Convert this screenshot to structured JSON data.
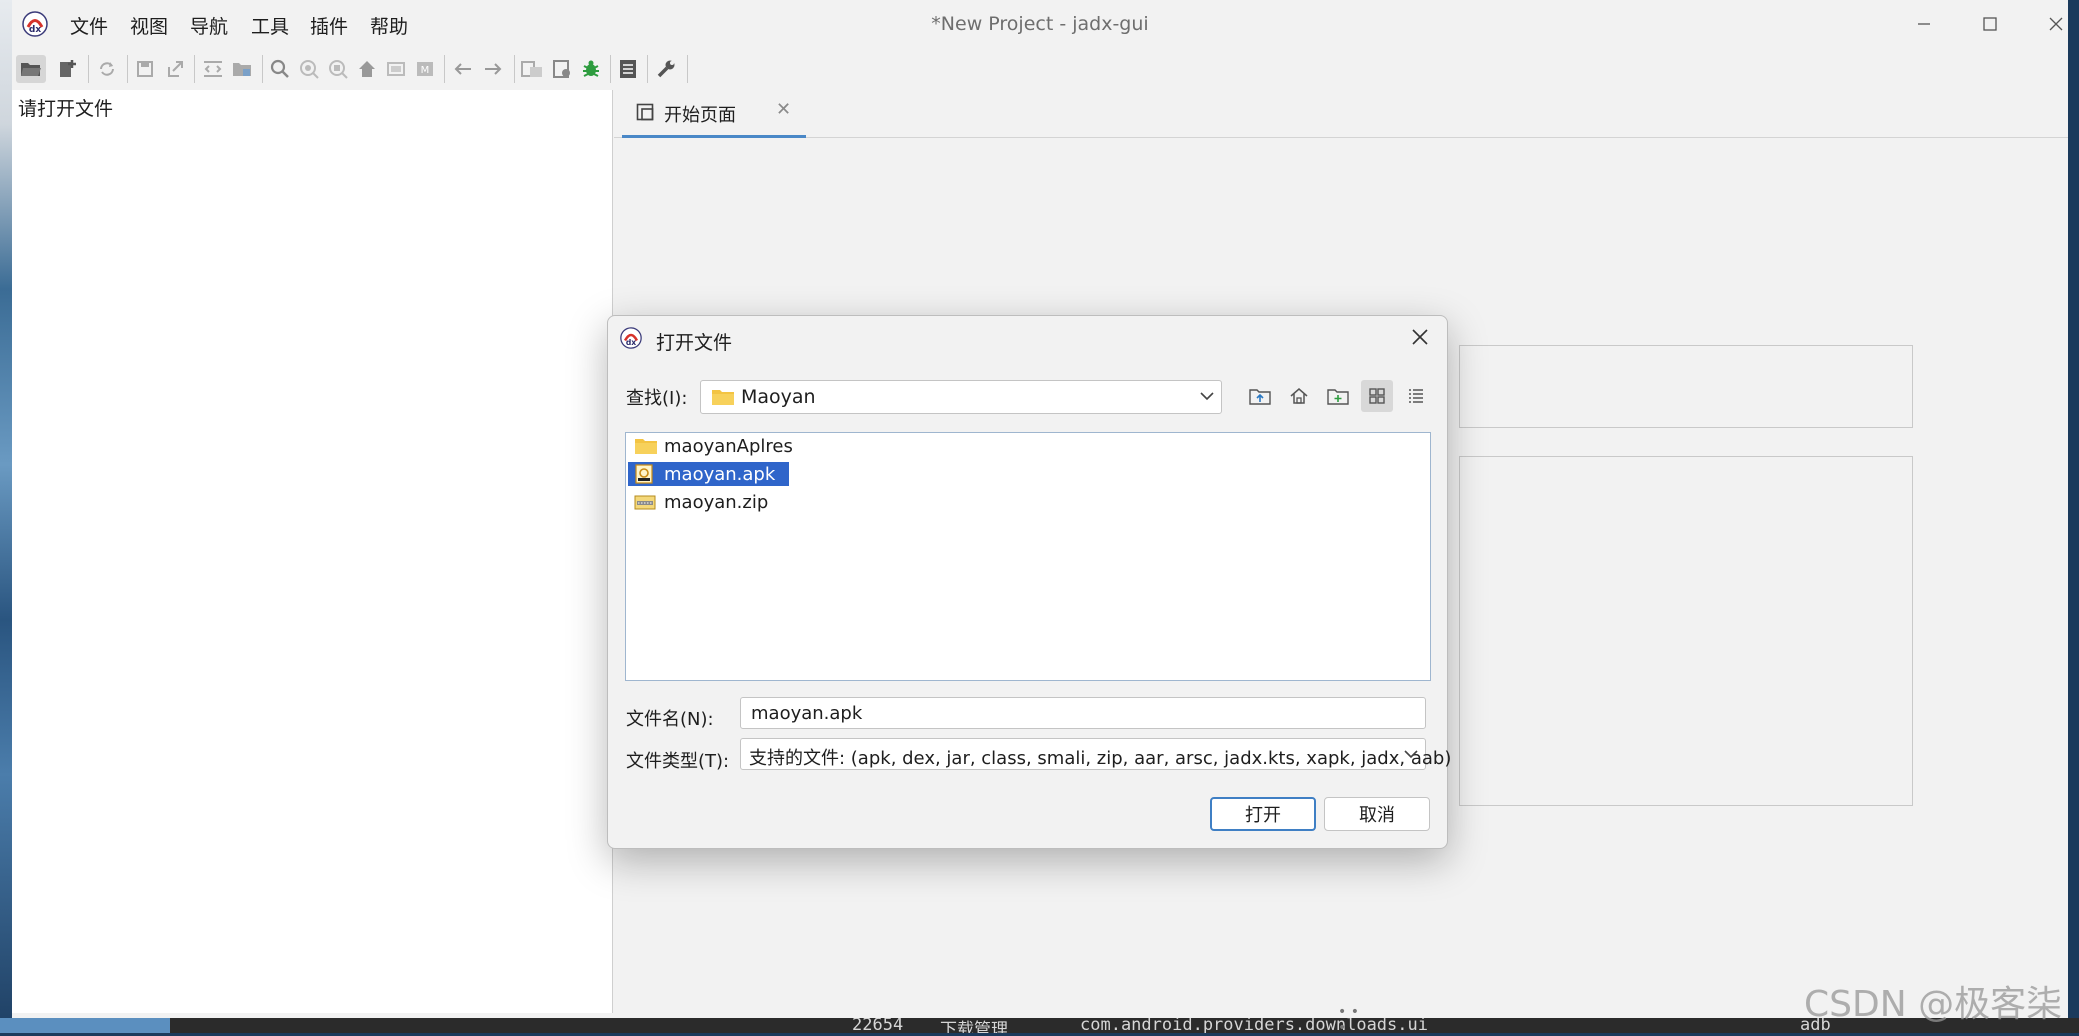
{
  "window": {
    "title": "*New Project - jadx-gui",
    "menu": [
      "文件",
      "视图",
      "导航",
      "工具",
      "插件",
      "帮助"
    ],
    "controls": {
      "minimize_icon": "minimize-icon",
      "maximize_icon": "maximize-icon",
      "close_icon": "close-icon"
    }
  },
  "toolbar": {
    "icons": [
      "open-folder-icon",
      "add-files-icon",
      "sync-icon",
      "save-icon",
      "export-icon",
      "collapse-icon",
      "flatten-packages-icon",
      "search-icon",
      "find-class-icon",
      "find-usage-icon",
      "home-icon",
      "text-icon",
      "mark-icon",
      "back-icon",
      "forward-icon",
      "decompile-icon",
      "quark-icon",
      "debug-icon",
      "log-icon",
      "preferences-icon"
    ],
    "selected": "open-folder-icon",
    "colors": {
      "debug": "#2e9c3f"
    }
  },
  "tree": {
    "empty_message": "请打开文件"
  },
  "tabs": [
    {
      "label": "开始页面",
      "active": true
    }
  ],
  "dialog": {
    "title": "打开文件",
    "look_in_label": "查找(I):",
    "look_in_value": "Maoyan",
    "files": [
      {
        "name": "maoyanAplres",
        "type": "folder",
        "selected": false
      },
      {
        "name": "maoyan.apk",
        "type": "apk",
        "selected": true
      },
      {
        "name": "maoyan.zip",
        "type": "zip",
        "selected": false
      }
    ],
    "file_name_label": "文件名(N):",
    "file_name_value": "maoyan.apk",
    "file_type_label": "文件类型(T):",
    "file_type_value": "支持的文件: (apk, dex, jar, class, smali, zip, aar, arsc, jadx.kts, xapk, jadx, aab)",
    "open_label": "打开",
    "cancel_label": "取消",
    "colors": {
      "selection": "#2f65ca",
      "default_button_border": "#3f7fc4",
      "folder": "#f3c443"
    }
  },
  "desktop_bottom": {
    "fragments": [
      "22654",
      "下载管理",
      "com.android.providers.downloads.ui",
      "adb"
    ]
  },
  "watermark": "CSDN @极客柒"
}
